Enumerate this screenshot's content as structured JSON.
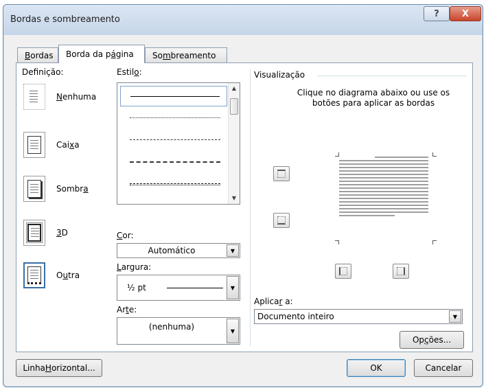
{
  "window": {
    "title": "Bordas e sombreamento",
    "help_glyph": "?",
    "close_glyph": "X"
  },
  "tabs": [
    {
      "pre": "",
      "ul": "B",
      "post": "ordas"
    },
    {
      "pre": "Borda da p",
      "ul": "á",
      "post": "gina"
    },
    {
      "pre": "So",
      "ul": "m",
      "post": "breamento"
    }
  ],
  "setting": {
    "label": "Definição:",
    "options": [
      {
        "pre": "",
        "ul": "N",
        "post": "enhuma",
        "icon": "page-none-icon"
      },
      {
        "pre": "Cai",
        "ul": "x",
        "post": "a",
        "icon": "page-box-icon"
      },
      {
        "pre": "Sombr",
        "ul": "a",
        "post": "",
        "icon": "page-shadow-icon"
      },
      {
        "pre": "",
        "ul": "3",
        "post": "D",
        "icon": "page-3d-icon"
      },
      {
        "pre": "O",
        "ul": "u",
        "post": "tra",
        "icon": "page-custom-icon"
      }
    ]
  },
  "style": {
    "label_pre": "Estil",
    "label_ul": "o",
    "label_post": ":",
    "items": [
      "solid",
      "dotted-fine",
      "dashed-small",
      "dashed",
      "dash-dot"
    ]
  },
  "color": {
    "label_pre": "",
    "label_ul": "C",
    "label_post": "or:",
    "value": "Automático"
  },
  "width": {
    "label_pre": "",
    "label_ul": "L",
    "label_post": "argura:",
    "value": "½ pt"
  },
  "art": {
    "label_pre": "Ar",
    "label_ul": "t",
    "label_post": "e:",
    "value": "(nenhuma)"
  },
  "preview": {
    "label": "Visualização",
    "instructions": "Clique no diagrama abaixo ou use os botões para aplicar as bordas"
  },
  "apply_to": {
    "label_pre": "Aplica",
    "label_ul": "r",
    "label_post": " a:",
    "value": "Documento inteiro"
  },
  "buttons": {
    "options": {
      "pre": "Op",
      "ul": "ç",
      "post": "ões..."
    },
    "horizontal": {
      "pre": "Linha ",
      "ul": "H",
      "post": "orizontal..."
    },
    "ok": "OK",
    "cancel": "Cancelar"
  }
}
